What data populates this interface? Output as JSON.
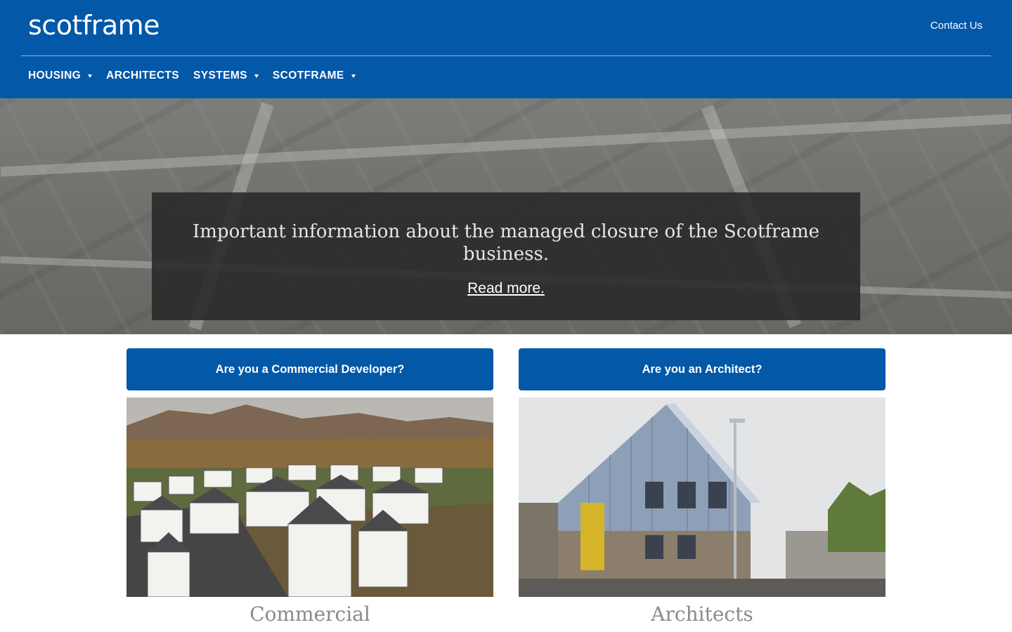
{
  "header": {
    "logo": "scotframe",
    "contact_label": "Contact Us",
    "nav": [
      {
        "label": "HOUSING"
      },
      {
        "label": "ARCHITECTS"
      },
      {
        "label": "SYSTEMS"
      },
      {
        "label": "SCOTFRAME"
      }
    ]
  },
  "hero": {
    "title": "Important information about the managed closure of the Scotframe business.",
    "link": "Read more."
  },
  "cards": [
    {
      "cta": "Are you a Commercial Developer?",
      "caption": "Commercial"
    },
    {
      "cta": "Are you an Architect?",
      "caption": "Architects"
    }
  ],
  "colors": {
    "brand_blue": "#0358a8",
    "overlay": "#282828"
  },
  "icons": [
    "caret-down-icon"
  ]
}
